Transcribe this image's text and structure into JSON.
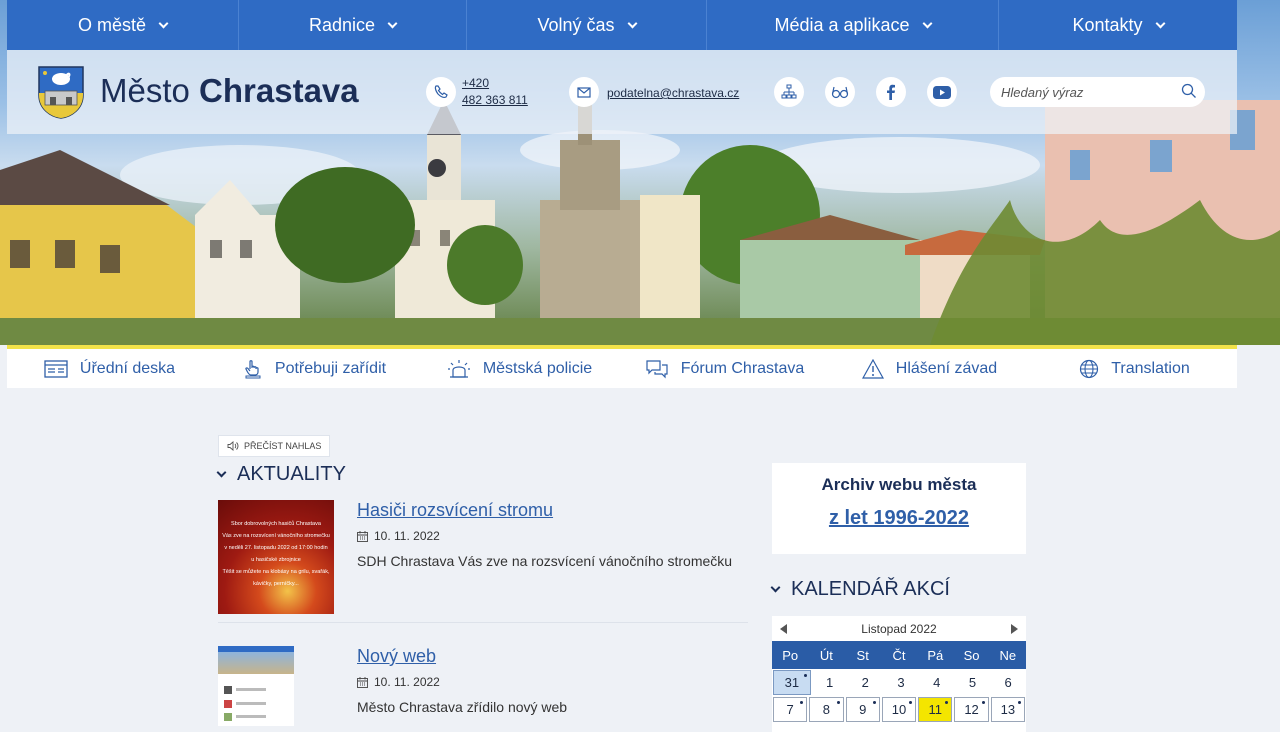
{
  "nav": {
    "items": [
      {
        "label": "O městě"
      },
      {
        "label": "Radnice"
      },
      {
        "label": "Volný čas"
      },
      {
        "label": "Média a aplikace"
      },
      {
        "label": "Kontakty"
      }
    ]
  },
  "header": {
    "title_prefix": "Město",
    "title_bold": "Chrastava",
    "phone_line1": "+420",
    "phone_line2": "482 363 811",
    "email": "podatelna@chrastava.cz",
    "search_placeholder": "Hledaný výraz"
  },
  "quick_links": [
    {
      "label": "Úřední deska",
      "icon": "notice-board-icon"
    },
    {
      "label": "Potřebuji zařídit",
      "icon": "hand-pointer-icon"
    },
    {
      "label": "Městská policie",
      "icon": "police-siren-icon"
    },
    {
      "label": "Fórum Chrastava",
      "icon": "chat-bubbles-icon"
    },
    {
      "label": "Hlášení závad",
      "icon": "warning-triangle-icon"
    },
    {
      "label": "Translation",
      "icon": "globe-icon"
    }
  ],
  "read_aloud": "PŘEČÍST NAHLAS",
  "news": {
    "heading": "AKTUALITY",
    "items": [
      {
        "title": "Hasiči rozsvícení stromu",
        "date": "10. 11. 2022",
        "desc": "SDH Chrastava Vás zve na rozsvícení vánočního stromečku",
        "thumb_lines": [
          "Sbor dobrovolných hasičů Chrastava",
          "Vás zve na rozsvícení vánočního stromečku",
          "v neděli 27. listopadu 2022 od 17:00 hodin",
          "u hasičské zbrojnice",
          "Těšit se můžete na klobásy na grilu, svařák, kávičky, perníčky..."
        ]
      },
      {
        "title": "Nový web",
        "date": "10. 11. 2022",
        "desc": "Město Chrastava zřídilo nový web"
      }
    ]
  },
  "archive": {
    "title": "Archiv webu města",
    "link": "z let 1996-2022"
  },
  "calendar": {
    "heading": "KALENDÁŘ AKCÍ",
    "month_label": "Listopad 2022",
    "weekdays": [
      "Po",
      "Út",
      "St",
      "Čt",
      "Pá",
      "So",
      "Ne"
    ],
    "rows": [
      [
        "31",
        "1",
        "2",
        "3",
        "4",
        "5",
        "6"
      ],
      [
        "7",
        "8",
        "9",
        "10",
        "11",
        "12",
        "13"
      ]
    ],
    "today": "11",
    "accent": "#f4e500"
  },
  "colors": {
    "nav_bg": "#2f6bc4",
    "link": "#2f5fa8",
    "heading": "#1b2e57",
    "quick_links_accent": "#f1e24a"
  }
}
